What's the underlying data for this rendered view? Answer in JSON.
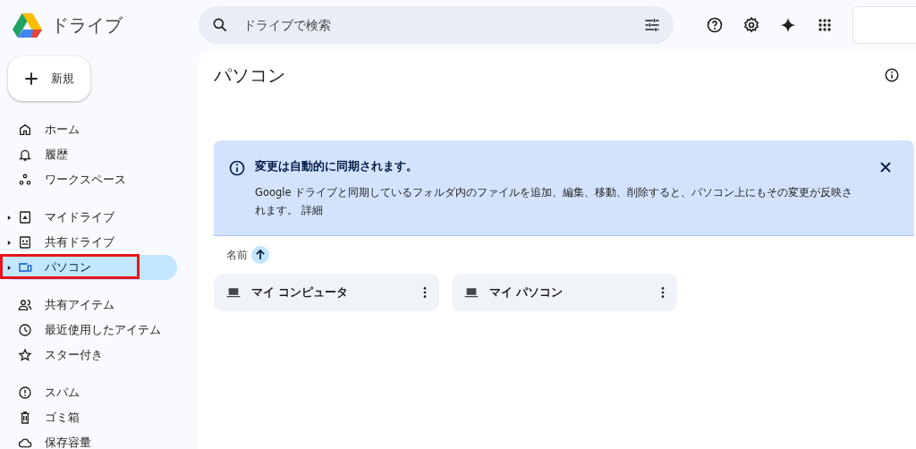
{
  "app": {
    "title": "ドライブ"
  },
  "new_button": {
    "label": "新規"
  },
  "sidebar": {
    "sections": [
      {
        "items": [
          {
            "label": "ホーム",
            "selected": false,
            "expandable": false,
            "highlighted": false
          },
          {
            "label": "履歴",
            "selected": false,
            "expandable": false,
            "highlighted": false
          },
          {
            "label": "ワークスペース",
            "selected": false,
            "expandable": false,
            "highlighted": false
          }
        ]
      },
      {
        "items": [
          {
            "label": "マイドライブ",
            "selected": false,
            "expandable": true,
            "highlighted": false
          },
          {
            "label": "共有ドライブ",
            "selected": false,
            "expandable": true,
            "highlighted": false
          },
          {
            "label": "パソコン",
            "selected": true,
            "expandable": true,
            "highlighted": true
          }
        ]
      },
      {
        "items": [
          {
            "label": "共有アイテム",
            "selected": false,
            "expandable": false,
            "highlighted": false
          },
          {
            "label": "最近使用したアイテム",
            "selected": false,
            "expandable": false,
            "highlighted": false
          },
          {
            "label": "スター付き",
            "selected": false,
            "expandable": false,
            "highlighted": false
          }
        ]
      },
      {
        "items": [
          {
            "label": "スパム",
            "selected": false,
            "expandable": false,
            "highlighted": false
          },
          {
            "label": "ゴミ箱",
            "selected": false,
            "expandable": false,
            "highlighted": false
          },
          {
            "label": "保存容量",
            "selected": false,
            "expandable": false,
            "highlighted": false
          }
        ]
      }
    ]
  },
  "search": {
    "placeholder": "ドライブで検索"
  },
  "page": {
    "title": "パソコン"
  },
  "banner": {
    "title": "変更は自動的に同期されます。",
    "text": "Google ドライブと同期しているフォルダ内のファイルを追加、編集、移動、削除すると、パソコン上にもその変更が反映されます。",
    "link": "詳細"
  },
  "sort": {
    "label": "名前"
  },
  "computers": [
    {
      "name": "マイ コンピュータ"
    },
    {
      "name": "マイ パソコン"
    }
  ]
}
